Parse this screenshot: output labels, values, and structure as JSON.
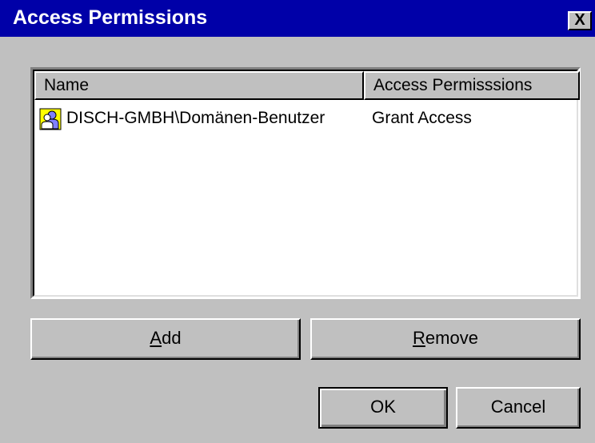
{
  "window": {
    "title": "Access Permissions",
    "close_label": "X"
  },
  "list": {
    "columns": [
      "Name",
      "Access Permisssions"
    ],
    "rows": [
      {
        "name": "DISCH-GMBH\\Domänen-Benutzer",
        "permission": "Grant Access",
        "icon": "user-group-icon"
      }
    ]
  },
  "buttons": {
    "add": {
      "mnemonic": "A",
      "rest": "dd"
    },
    "remove": {
      "mnemonic": "R",
      "rest": "emove"
    },
    "ok": "OK",
    "cancel": "Cancel"
  },
  "colors": {
    "titlebar": "#0000a8",
    "face": "#c0c0c0",
    "window": "#ffffff"
  }
}
